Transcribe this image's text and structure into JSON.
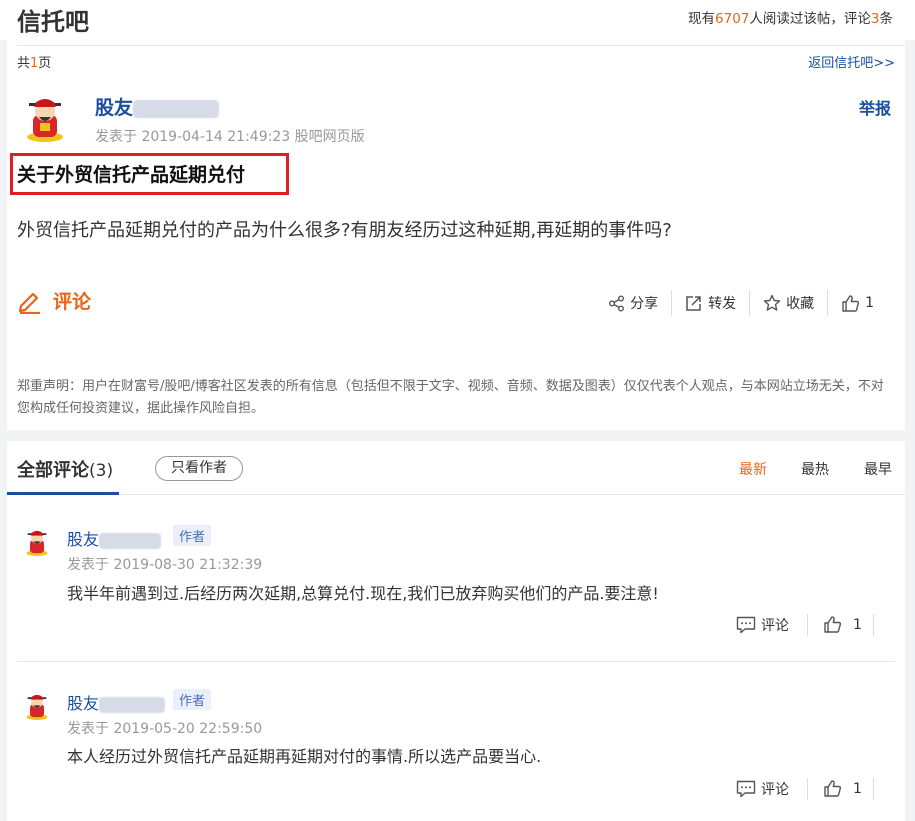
{
  "header": {
    "forum_title": "信托吧",
    "stats_prefix": "现有",
    "read_count": "6707",
    "stats_middle": "人阅读过该帖，评论",
    "comment_count": "3",
    "stats_suffix": "条"
  },
  "pagination": {
    "prefix": "共",
    "pages": "1",
    "suffix": "页"
  },
  "back_link": "返回信托吧>>",
  "post": {
    "author_prefix": "股友",
    "meta": "发表于 2019-04-14 21:49:23 股吧网页版",
    "report": "举报",
    "title": "关于外贸信托产品延期兑付",
    "body": "外贸信托产品延期兑付的产品为什么很多?有朋友经历过这种延期,再延期的事件吗?",
    "comment_label": "评论",
    "actions": {
      "share": "分享",
      "forward": "转发",
      "favorite": "收藏",
      "likes": "1"
    },
    "disclaimer": "郑重声明：用户在财富号/股吧/博客社区发表的所有信息（包括但不限于文字、视频、音频、数据及图表）仅仅代表个人观点，与本网站立场无关，不对您构成任何投资建议，据此操作风险自担。"
  },
  "comments_section": {
    "title": "全部评论",
    "count": "(3)",
    "author_only": "只看作者",
    "sort": {
      "newest": "最新",
      "hottest": "最热",
      "earliest": "最早"
    },
    "active_sort_color": "#e8641b"
  },
  "comments": [
    {
      "author_prefix": "股友",
      "tag": "作者",
      "meta": "发表于 2019-08-30 21:32:39",
      "text": "我半年前遇到过.后经历两次延期,总算兑付.现在,我们已放弃购买他们的产品.要注意!",
      "reply": "评论",
      "likes": "1"
    },
    {
      "author_prefix": "股友",
      "tag": "作者",
      "meta": "发表于 2019-05-20 22:59:50",
      "text": "本人经历过外贸信托产品延期再延期对付的事情.所以选产品要当心.",
      "reply": "评论",
      "likes": "1"
    }
  ],
  "colors": {
    "accent": "#e8641b",
    "link": "#1a4fa0",
    "highlight_box": "#e02020"
  }
}
